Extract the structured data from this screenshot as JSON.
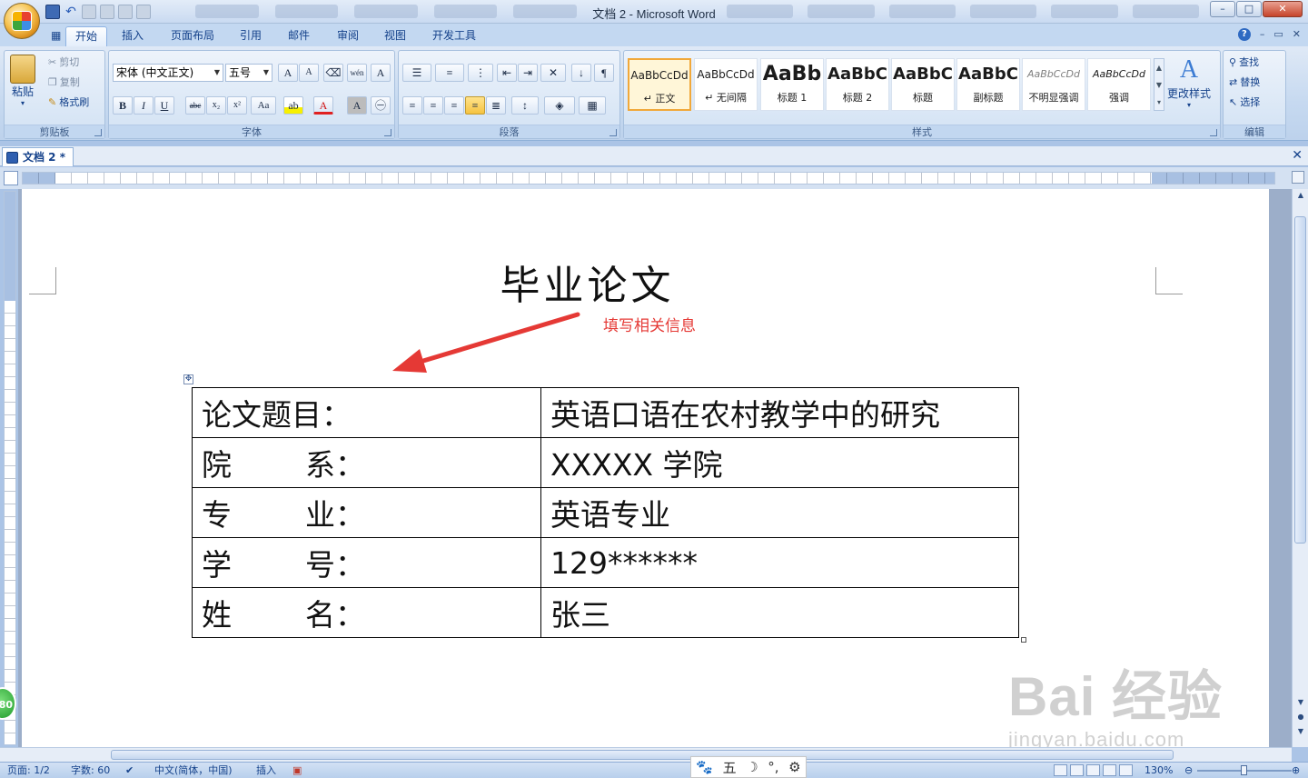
{
  "window": {
    "title": "文档 2 - Microsoft Word",
    "controls": [
      "–",
      "□",
      "✕"
    ]
  },
  "ribbon_tabs": [
    "开始",
    "插入",
    "页面布局",
    "引用",
    "邮件",
    "审阅",
    "视图",
    "开发工具"
  ],
  "clipboard": {
    "paste": "粘贴",
    "cut": "剪切",
    "copy": "复制",
    "format_painter": "格式刷",
    "label": "剪贴板"
  },
  "font": {
    "name": "宋体 (中文正文)",
    "size": "五号",
    "label": "字体",
    "buttons": [
      "B",
      "I",
      "U",
      "abc",
      "x₂",
      "x²",
      "Aa"
    ]
  },
  "paragraph": {
    "label": "段落"
  },
  "styles": {
    "label": "样式",
    "tiles": [
      {
        "sample": "AaBbCcDd",
        "name": "↵ 正文"
      },
      {
        "sample": "AaBbCcDd",
        "name": "↵ 无间隔"
      },
      {
        "sample": "AaBb",
        "name": "标题 1"
      },
      {
        "sample": "AaBbC",
        "name": "标题 2"
      },
      {
        "sample": "AaBbC",
        "name": "标题"
      },
      {
        "sample": "AaBbC",
        "name": "副标题"
      },
      {
        "sample": "AaBbCcDd",
        "name": "不明显强调"
      },
      {
        "sample": "AaBbCcDd",
        "name": "强调"
      }
    ],
    "change_styles": "更改样式"
  },
  "editing": {
    "label": "编辑",
    "find": "查找",
    "replace": "替换",
    "select": "选择"
  },
  "document_tab": "文档 2 *",
  "document": {
    "title": "毕业论文",
    "annotation": "填写相关信息",
    "rows": [
      {
        "key_a": "论文题目：",
        "key_b": "",
        "value": "英语口语在农村教学中的研究"
      },
      {
        "key_a": "院",
        "key_b": "系：",
        "value": "XXXXX 学院"
      },
      {
        "key_a": "专",
        "key_b": "业：",
        "value": "英语专业"
      },
      {
        "key_a": "学",
        "key_b": "号：",
        "value": "129******"
      },
      {
        "key_a": "姓",
        "key_b": "名：",
        "value": "张三"
      }
    ]
  },
  "watermark": {
    "line1": "Bai 经验",
    "line2": "jingyan.baidu.com"
  },
  "badge": "80",
  "status": {
    "page": "页面: 1/2",
    "words": "字数: 60",
    "language": "中文(简体，中国)",
    "mode": "插入",
    "zoom": "130%"
  },
  "ime": [
    "五",
    "☽",
    "°,",
    "⚙"
  ],
  "colors": {
    "annotation": "#e53935",
    "ribbon": "#c6d9f0",
    "workspace": "#9caec9"
  }
}
